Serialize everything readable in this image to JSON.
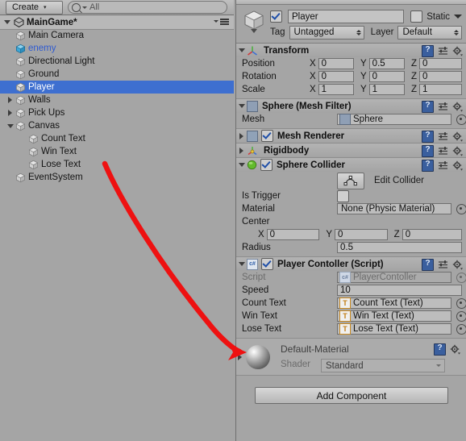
{
  "app": "Unity Editor",
  "hierarchy": {
    "toolbar": {
      "create_label": "Create",
      "create_caret": "▾",
      "search_value": "All",
      "search_icon": "search-icon"
    },
    "scene": {
      "name": "MainGame*",
      "expanded": true,
      "menu_icon": "hamburger-menu-icon"
    },
    "items": [
      {
        "label": "Main Camera",
        "indent": 1,
        "fold": "none",
        "type": "gameobject",
        "selected": false,
        "prefab": false
      },
      {
        "label": "enemy",
        "indent": 1,
        "fold": "none",
        "type": "prefab",
        "selected": false,
        "prefab": true
      },
      {
        "label": "Directional Light",
        "indent": 1,
        "fold": "none",
        "type": "gameobject",
        "selected": false,
        "prefab": false
      },
      {
        "label": "Ground",
        "indent": 1,
        "fold": "none",
        "type": "gameobject",
        "selected": false,
        "prefab": false
      },
      {
        "label": "Player",
        "indent": 1,
        "fold": "none",
        "type": "gameobject",
        "selected": true,
        "prefab": false
      },
      {
        "label": "Walls",
        "indent": 1,
        "fold": "closed",
        "type": "gameobject",
        "selected": false,
        "prefab": false
      },
      {
        "label": "Pick Ups",
        "indent": 1,
        "fold": "closed",
        "type": "gameobject",
        "selected": false,
        "prefab": false
      },
      {
        "label": "Canvas",
        "indent": 1,
        "fold": "open",
        "type": "gameobject",
        "selected": false,
        "prefab": false
      },
      {
        "label": "Count Text",
        "indent": 2,
        "fold": "none",
        "type": "gameobject",
        "selected": false,
        "prefab": false
      },
      {
        "label": "Win Text",
        "indent": 2,
        "fold": "none",
        "type": "gameobject",
        "selected": false,
        "prefab": false
      },
      {
        "label": "Lose Text",
        "indent": 2,
        "fold": "none",
        "type": "gameobject",
        "selected": false,
        "prefab": false
      },
      {
        "label": "EventSystem",
        "indent": 1,
        "fold": "none",
        "type": "gameobject",
        "selected": false,
        "prefab": false
      }
    ]
  },
  "inspector": {
    "header": {
      "enabled": true,
      "name": "Player",
      "static_label": "Static",
      "static_checked": false,
      "tag_label": "Tag",
      "tag_value": "Untagged",
      "layer_label": "Layer",
      "layer_value": "Default"
    },
    "transform": {
      "title": "Transform",
      "rows": [
        {
          "label": "Position",
          "x": "0",
          "y": "0.5",
          "z": "0"
        },
        {
          "label": "Rotation",
          "x": "0",
          "y": "0",
          "z": "0"
        },
        {
          "label": "Scale",
          "x": "1",
          "y": "1",
          "z": "1"
        }
      ],
      "axes": [
        "X",
        "Y",
        "Z"
      ]
    },
    "mesh_filter": {
      "title": "Sphere (Mesh Filter)",
      "mesh_label": "Mesh",
      "mesh_value": "Sphere"
    },
    "mesh_renderer": {
      "title": "Mesh Renderer",
      "enabled": true
    },
    "rigidbody": {
      "title": "Rigidbody"
    },
    "sphere_collider": {
      "title": "Sphere Collider",
      "enabled": true,
      "edit_collider_label": "Edit Collider",
      "is_trigger_label": "Is Trigger",
      "is_trigger_checked": false,
      "material_label": "Material",
      "material_value": "None (Physic Material)",
      "center_label": "Center",
      "center": {
        "x": "0",
        "y": "0",
        "z": "0"
      },
      "radius_label": "Radius",
      "radius_value": "0.5"
    },
    "player_controller": {
      "title": "Player Contoller (Script)",
      "enabled": true,
      "script_label": "Script",
      "script_value": "PlayerContoller",
      "fields": [
        {
          "label": "Speed",
          "value": "10",
          "kind": "number"
        },
        {
          "label": "Count Text",
          "value": "Count Text (Text)",
          "kind": "object"
        },
        {
          "label": "Win Text",
          "value": "Win Text (Text)",
          "kind": "object"
        },
        {
          "label": "Lose Text",
          "value": "Lose Text (Text)",
          "kind": "object"
        }
      ]
    },
    "material_preview": {
      "name": "Default-Material",
      "shader_label": "Shader",
      "shader_value": "Standard"
    },
    "add_component_label": "Add Component"
  },
  "annotation": {
    "type": "red-arrow",
    "color": "#ee1111",
    "from_label": "Lose Text",
    "to_label": "Lose Text field"
  },
  "colors": {
    "panel_bg": "#a5a5a5",
    "selection_blue": "#3e6fd0",
    "prefab_blue": "#2f5bd1",
    "annotation_red": "#ee1111"
  }
}
